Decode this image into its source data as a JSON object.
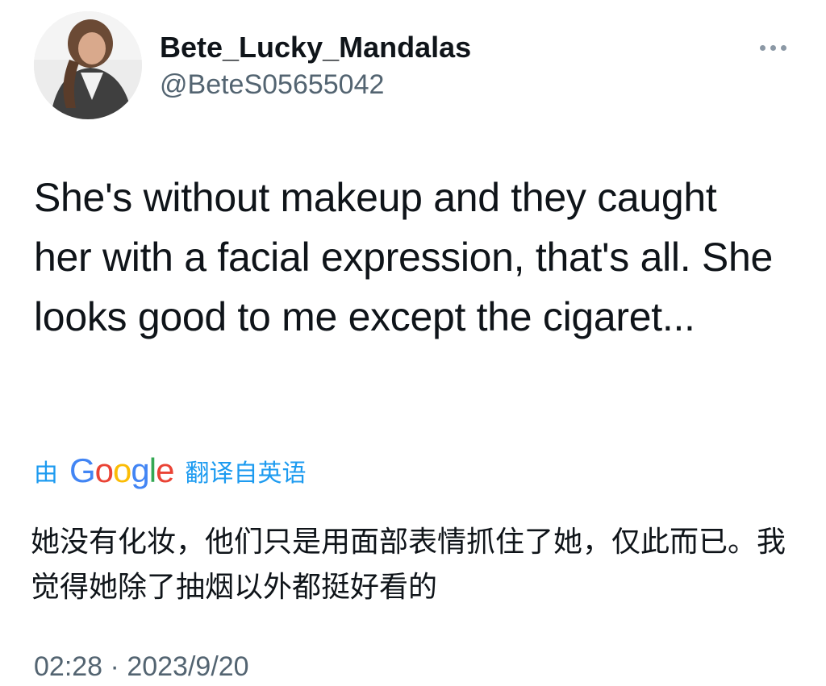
{
  "user": {
    "display_name": "Bete_Lucky_Mandalas",
    "handle": "@BeteS05655042",
    "avatar_icon": "user-avatar-photo"
  },
  "more_icon": "more-horizontal-icon",
  "tweet": {
    "text": "She's without makeup and they caught her with a facial expression, that's all. She looks good to me except the cigaret..."
  },
  "translation": {
    "by_label": "由",
    "google_logo": "Google",
    "from_label": "翻译自英语",
    "text": "她没有化妆，他们只是用面部表情抓住了她，仅此而已。我觉得她除了抽烟以外都挺好看的"
  },
  "meta": {
    "time": "02:28",
    "separator": "·",
    "date": "2023/9/20"
  },
  "colors": {
    "link": "#1d9bf0",
    "secondary": "#536471",
    "text": "#0f1419"
  }
}
